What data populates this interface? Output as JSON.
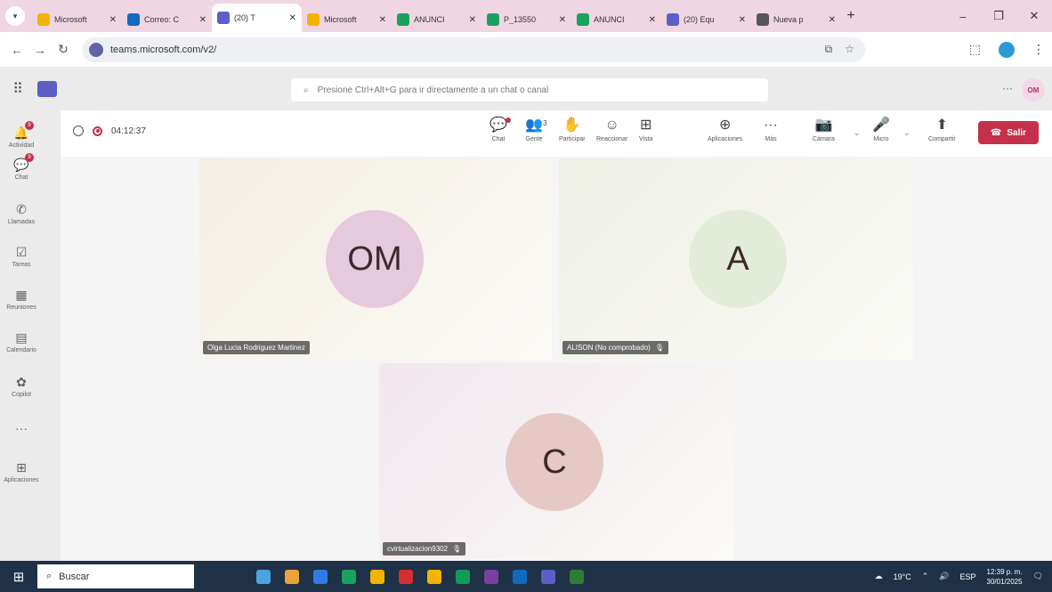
{
  "browser": {
    "tabs": [
      {
        "title": "Microsoft",
        "color": "#f3b400"
      },
      {
        "title": "Correo: C",
        "color": "#0f6cbd"
      },
      {
        "title": "(20) T",
        "color": "#5b5fc7",
        "active": true
      },
      {
        "title": "Microsoft",
        "color": "#f3b400"
      },
      {
        "title": "ANUNCI",
        "color": "#1aa260"
      },
      {
        "title": "P_13550",
        "color": "#1aa260"
      },
      {
        "title": "ANUNCI",
        "color": "#1aa260"
      },
      {
        "title": "(20) Equ",
        "color": "#5b5fc7"
      },
      {
        "title": "Nueva p",
        "color": "#555555"
      }
    ],
    "new_tab": "+",
    "url": "teams.microsoft.com/v2/"
  },
  "teams": {
    "search_placeholder": "Presione Ctrl+Alt+G para ir directamente a un chat o canal",
    "user_initials": "OM",
    "more": "···"
  },
  "rail": [
    {
      "label": "Actividad",
      "icon": "bell-icon",
      "glyph": "🔔",
      "badge": "9"
    },
    {
      "label": "Chat",
      "icon": "chat-icon",
      "glyph": "💬",
      "badge": "9"
    },
    {
      "label": "Llamadas",
      "icon": "phone-icon",
      "glyph": "✆"
    },
    {
      "label": "Tareas",
      "icon": "tasks-icon",
      "glyph": "☑"
    },
    {
      "label": "Reuniones",
      "icon": "meetings-icon",
      "glyph": "▦"
    },
    {
      "label": "Calendario",
      "icon": "calendar-icon",
      "glyph": "▤"
    },
    {
      "label": "Copilot",
      "icon": "copilot-icon",
      "glyph": "✿"
    },
    {
      "label": "",
      "icon": "more-apps-icon",
      "glyph": "···"
    },
    {
      "label": "Aplicaciones",
      "icon": "apps-icon",
      "glyph": "⊞"
    }
  ],
  "meeting": {
    "timer": "04:12:37",
    "tools": [
      {
        "label": "Chat",
        "icon": "chat-icon",
        "glyph": "💬"
      },
      {
        "label": "Gente",
        "icon": "people-icon",
        "glyph": "👥",
        "count": "3"
      },
      {
        "label": "Participar",
        "icon": "raise-hand-icon",
        "glyph": "✋"
      },
      {
        "label": "Reaccionar",
        "icon": "react-icon",
        "glyph": "☺"
      },
      {
        "label": "Vista",
        "icon": "view-icon",
        "glyph": "⊞"
      },
      {
        "label": "Aplicaciones",
        "icon": "apps-icon",
        "glyph": "⊕"
      },
      {
        "label": "Más",
        "icon": "more-icon",
        "glyph": "···"
      },
      {
        "label": "Cámara",
        "icon": "camera-off-icon",
        "glyph": "📷"
      },
      {
        "label": "Micro",
        "icon": "mic-icon",
        "glyph": "🎤"
      },
      {
        "label": "Compartir",
        "icon": "share-icon",
        "glyph": "⬆"
      }
    ],
    "leave_label": "Salir",
    "participants": [
      {
        "initials": "OM",
        "name": "Olga Lucia Rodriguez Martinez",
        "bg": "#f4efe4",
        "avatar_bg": "#e6c9dd",
        "muted": false
      },
      {
        "initials": "A",
        "name": "ALISON (No comprobado)",
        "bg": "#eef0e6",
        "avatar_bg": "#e3ecd8",
        "muted": true
      },
      {
        "initials": "C",
        "name": "cvirtualizacion9302",
        "bg": "#f1e7ee",
        "avatar_bg": "#e6c8c5",
        "muted": true
      }
    ]
  },
  "taskbar": {
    "search_label": "Buscar",
    "weather": "19°C",
    "lang": "ESP",
    "time": "12:39 p. m.",
    "date": "30/01/2025",
    "apps_colors": [
      "#4aa3df",
      "#e8a33a",
      "#2f7be6",
      "#1aa260",
      "#f3b400",
      "#d32f2f",
      "#f3b400",
      "#0f9d58",
      "#7b3fa0",
      "#0f6cbd",
      "#5b5fc7",
      "#2e7d32"
    ]
  }
}
